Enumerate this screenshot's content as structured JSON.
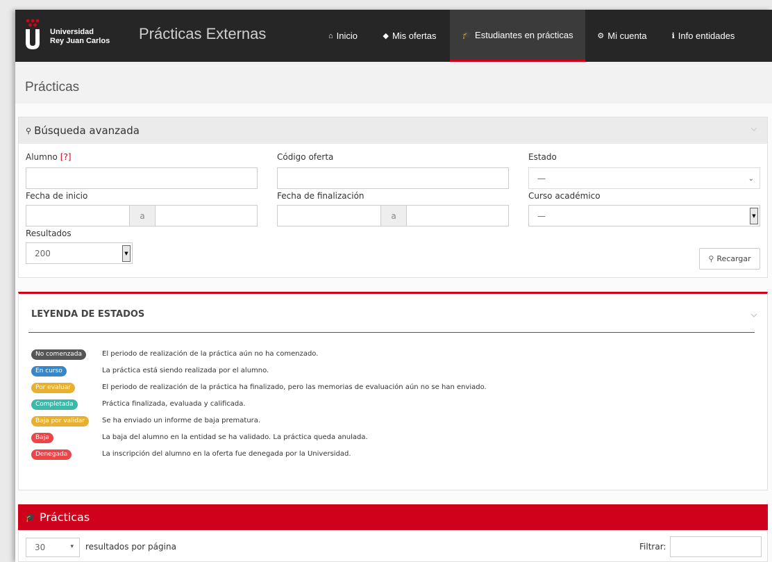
{
  "colors": {
    "accent": "#d0021b",
    "navbar": "#262626",
    "panel_heading": "#ebebeb"
  },
  "navbar": {
    "brand_line1": "Universidad",
    "brand_line2": "Rey Juan Carlos",
    "app_title": "Prácticas Externas",
    "items": [
      {
        "label": "Inicio",
        "icon": "home-icon",
        "glyph": "⌂"
      },
      {
        "label": "Mis ofertas",
        "icon": "tags-icon",
        "glyph": "◆"
      },
      {
        "label": "Estudiantes en prácticas",
        "icon": "graduation-cap-icon",
        "glyph": "🎓"
      },
      {
        "label": "Mi cuenta",
        "icon": "gears-icon",
        "glyph": "⚙"
      },
      {
        "label": "Info entidades",
        "icon": "info-circle-icon",
        "glyph": "ℹ"
      }
    ],
    "active_item": "Estudiantes en prácticas"
  },
  "page": {
    "title": "Prácticas"
  },
  "search": {
    "heading": "Búsqueda avanzada",
    "alumno_label": "Alumno",
    "alumno_help": "[?]",
    "codigo_label": "Código oferta",
    "estado_label": "Estado",
    "estado_value": "—",
    "fecha_inicio_label": "Fecha de inicio",
    "fecha_fin_label": "Fecha de finalización",
    "range_sep": "a",
    "curso_label": "Curso académico",
    "curso_value": "—",
    "resultados_label": "Resultados",
    "resultados_value": "200",
    "reload_button": "Recargar"
  },
  "legend": {
    "title": "LEYENDA DE ESTADOS",
    "items": [
      {
        "badge": "No comenzada",
        "color": "#555555",
        "desc": "El periodo de realización de la práctica aún no ha comenzado."
      },
      {
        "badge": "En curso",
        "color": "#3a87c8",
        "desc": "La práctica está siendo realizada por el alumno."
      },
      {
        "badge": "Por evaluar",
        "color": "#e8b030",
        "desc": "El periodo de realización de la práctica ha finalizado, pero las memorias de evaluación aún no se han enviado."
      },
      {
        "badge": "Completada",
        "color": "#3bb8a8",
        "desc": "Práctica finalizada, evaluada y calificada."
      },
      {
        "badge": "Baja por validar",
        "color": "#e8b030",
        "desc": "Se ha enviado un informe de baja prematura."
      },
      {
        "badge": "Baja",
        "color": "#e8464a",
        "desc": "La baja del alumno en la entidad se ha validado. La práctica queda anulada."
      },
      {
        "badge": "Denegada",
        "color": "#e8464a",
        "desc": "La inscripción del alumno en la oferta fue denegada por la Universidad."
      }
    ]
  },
  "practicas": {
    "heading": "Prácticas",
    "per_page_value": "30",
    "per_page_label": "resultados por página",
    "filter_label": "Filtrar:"
  }
}
